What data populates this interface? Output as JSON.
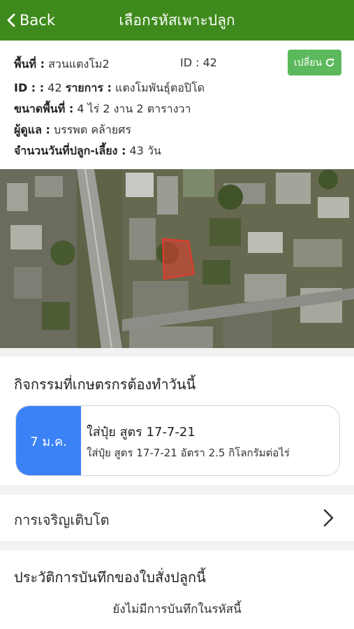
{
  "header": {
    "back_label": "Back",
    "title": "เลือกรหัสเพาะปลูก"
  },
  "info": {
    "area_label": "พื้นที่ :",
    "area_value": "สวนแตงโม2",
    "id_top": "ID : 42",
    "change_button": "เปลี่ยน",
    "id_label": "ID : :",
    "id_value": "42",
    "item_label": "รายการ :",
    "item_value": "แตงโมพันธุ์ตอปิโด",
    "size_label": "ขนาดพื้นที่ :",
    "size_value": "4 ไร่ 2 งาน 2 ตารางวา",
    "caretaker_label": "ผู้ดูแล :",
    "caretaker_value": "บรรพต คล้ายศร",
    "days_label": "จำนวนวันที่ปลูก-เลี้ยง :",
    "days_value": "43 วัน"
  },
  "map": {
    "plot_color": "#e53a2b"
  },
  "activities": {
    "title": "กิจกรรมที่เกษตรกรต้องทำวันนี้",
    "items": [
      {
        "date": "7 ม.ค.",
        "title": "ใส่ปุ๋ย สูตร 17-7-21",
        "desc": "ใส่ปุ๋ย สูตร 17-7-21 อัตรา 2.5 กิโลกรัมต่อไร่"
      }
    ]
  },
  "growth": {
    "label": "การเจริญเติบโต"
  },
  "history": {
    "title": "ประวัติการบันทึกของใบสั่งปลูกนี้",
    "empty": "ยังไม่มีการบันทึกในรหัสนี้"
  },
  "colors": {
    "header": "#3f8a1c",
    "button": "#5cb85c",
    "date_box": "#3b82f6"
  }
}
